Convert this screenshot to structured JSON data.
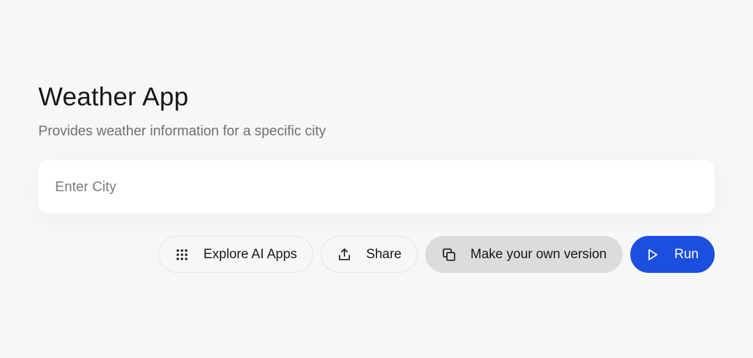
{
  "app": {
    "title": "Weather App",
    "description": "Provides weather information for a specific city"
  },
  "city_input": {
    "placeholder": "Enter City",
    "value": ""
  },
  "actions": {
    "explore_label": "Explore AI Apps",
    "share_label": "Share",
    "make_version_label": "Make your own version",
    "run_label": "Run"
  },
  "icons": {
    "explore": "grid-dots-icon",
    "share": "share-upload-icon",
    "make_version": "copy-icon",
    "run": "play-icon"
  },
  "colors": {
    "background": "#f7f7f7",
    "primary": "#1c4fe0",
    "make_version_bg": "#dcdcdc"
  }
}
